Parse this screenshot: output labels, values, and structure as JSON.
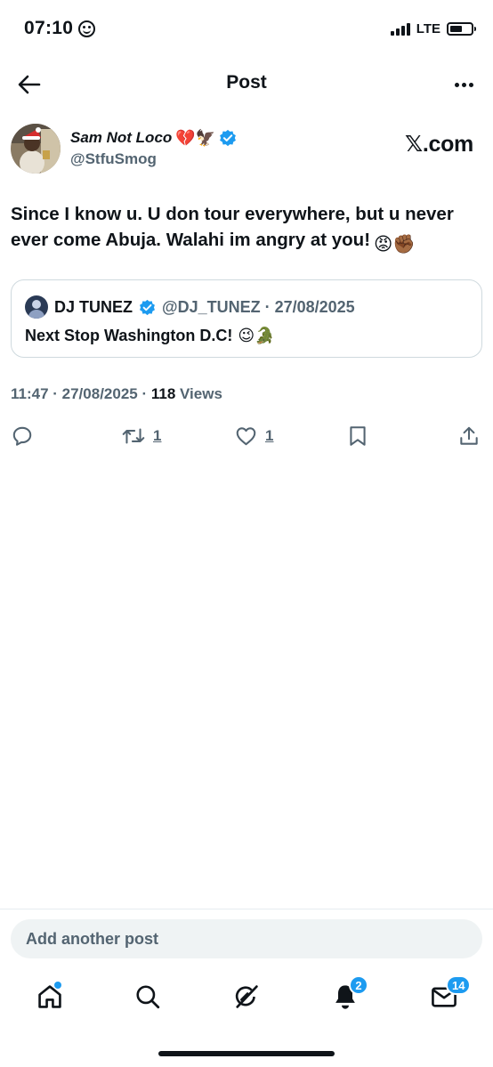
{
  "status_bar": {
    "time": "07:10",
    "network": "LTE"
  },
  "header": {
    "title": "Post"
  },
  "author": {
    "display_name": "Sam Not Loco",
    "name_emojis": "💔🦅",
    "handle": "@StfuSmog",
    "brand": "𝕏.com"
  },
  "post": {
    "text": "Since I know u. U don tour everywhere, but u never ever come Abuja. Walahi im angry at you!",
    "emojis": "😡✊🏾"
  },
  "quote": {
    "name": "DJ TUNEZ",
    "handle_date": "@DJ_TUNEZ · 27/08/2025",
    "text": "Next Stop Washington D.C!",
    "emojis": "😉🐊"
  },
  "meta": {
    "time_date": "11:47 · 27/08/2025 · ",
    "views_count": "118",
    "views_label": "Views"
  },
  "actions": {
    "retweets": "1",
    "likes": "1"
  },
  "reply": {
    "placeholder": "Add another post"
  },
  "nav": {
    "notifications_badge": "2",
    "messages_badge": "14"
  },
  "colors": {
    "accent": "#1d9bf0",
    "secondary_text": "#536471",
    "primary_text": "#0f1419"
  }
}
